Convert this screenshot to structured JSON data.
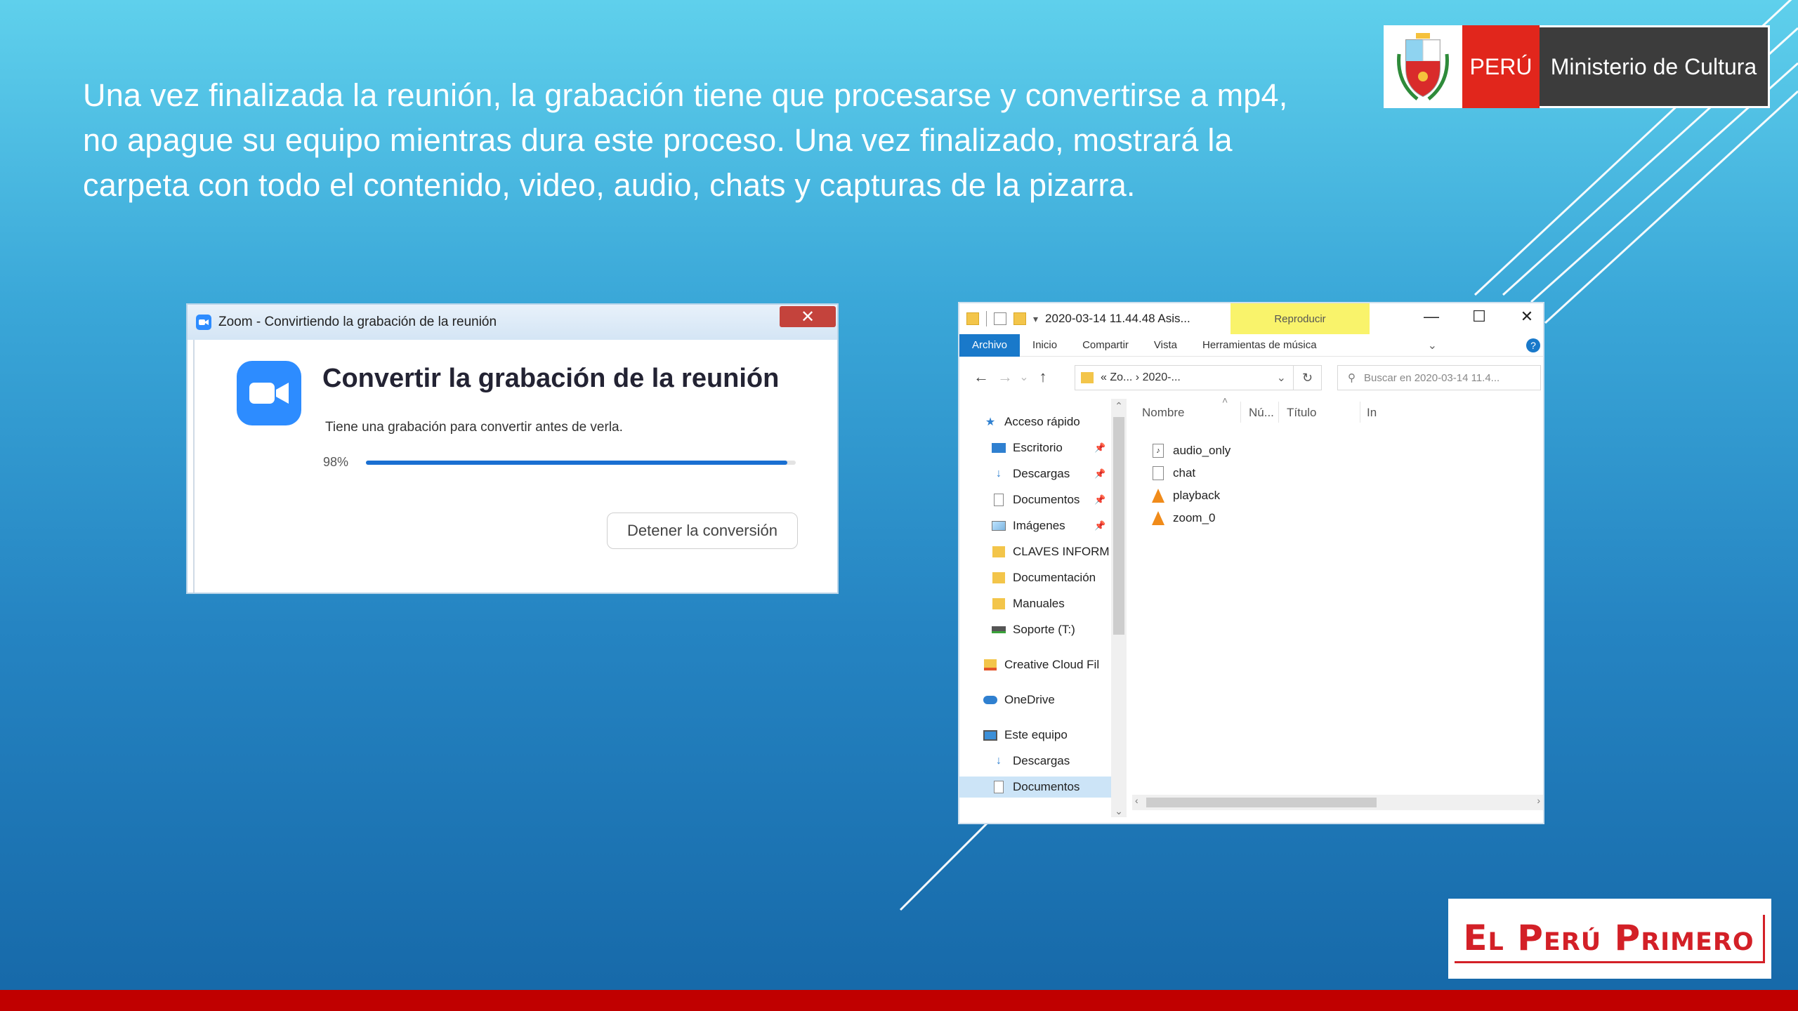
{
  "slide": {
    "body_text": "Una vez finalizada la reunión, la grabación tiene que procesarse y convertirse a mp4, no apague su equipo mientras dura este proceso. Una vez finalizado, mostrará la carpeta con todo el contenido, video, audio, chats y capturas de la pizarra."
  },
  "gov_logo": {
    "country": "PERÚ",
    "ministry": "Ministerio de Cultura"
  },
  "footer_logo": {
    "text": "El Perú Primero"
  },
  "zoom_dialog": {
    "window_title": "Zoom - Convirtiendo la grabación de la reunión",
    "close_glyph": "✕",
    "heading": "Convertir la grabación de la reunión",
    "subtitle": "Tiene una grabación para convertir antes de verla.",
    "progress_label": "98%",
    "progress_value": 0.98,
    "stop_button": "Detener la conversión"
  },
  "explorer": {
    "window_title": "2020-03-14 11.44.48 Asis...",
    "contextual_tab": "Reproducir",
    "window_buttons": {
      "minimize": "—",
      "maximize": "☐",
      "close": "✕"
    },
    "ribbon_tabs": [
      "Archivo",
      "Inicio",
      "Compartir",
      "Vista",
      "Herramientas de música"
    ],
    "help": "?",
    "nav": {
      "back": "←",
      "forward": "→",
      "recent": "⌄",
      "up": "↑"
    },
    "path": "«  Zo...  ›  2020-...",
    "path_dropdown": "⌄",
    "refresh": "↻",
    "search_placeholder": "Buscar en 2020-03-14 11.4...",
    "nav_pane": [
      {
        "label": "Acceso rápido",
        "icon": "star-icon",
        "pinned": false
      },
      {
        "label": "Escritorio",
        "icon": "desktop-icon",
        "pinned": true
      },
      {
        "label": "Descargas",
        "icon": "download-icon",
        "pinned": true
      },
      {
        "label": "Documentos",
        "icon": "document-icon",
        "pinned": true
      },
      {
        "label": "Imágenes",
        "icon": "image-icon",
        "pinned": true
      },
      {
        "label": "CLAVES INFORM",
        "icon": "folder-icon",
        "pinned": false
      },
      {
        "label": "Documentación",
        "icon": "folder-icon",
        "pinned": false
      },
      {
        "label": "Manuales",
        "icon": "folder-icon",
        "pinned": false
      },
      {
        "label": "Soporte (T:)",
        "icon": "network-drive-icon",
        "pinned": false
      },
      {
        "label": "Creative Cloud Fil",
        "icon": "creative-cloud-icon",
        "pinned": false
      },
      {
        "label": "OneDrive",
        "icon": "onedrive-icon",
        "pinned": false
      },
      {
        "label": "Este equipo",
        "icon": "computer-icon",
        "pinned": false
      },
      {
        "label": "Descargas",
        "icon": "download-icon",
        "pinned": false
      },
      {
        "label": "Documentos",
        "icon": "document-icon",
        "pinned": false,
        "selected": true
      }
    ],
    "columns": [
      "Nombre",
      "Nú...",
      "Título",
      "In"
    ],
    "files": [
      {
        "name": "audio_only",
        "icon": "audio-file-icon"
      },
      {
        "name": "chat",
        "icon": "text-file-icon"
      },
      {
        "name": "playback",
        "icon": "vlc-icon"
      },
      {
        "name": "zoom_0",
        "icon": "vlc-icon"
      }
    ]
  },
  "colors": {
    "peru_red": "#e1261c",
    "zoom_blue": "#2d8cff",
    "ribbon_blue": "#1979ca",
    "footer_red": "#c00000"
  }
}
